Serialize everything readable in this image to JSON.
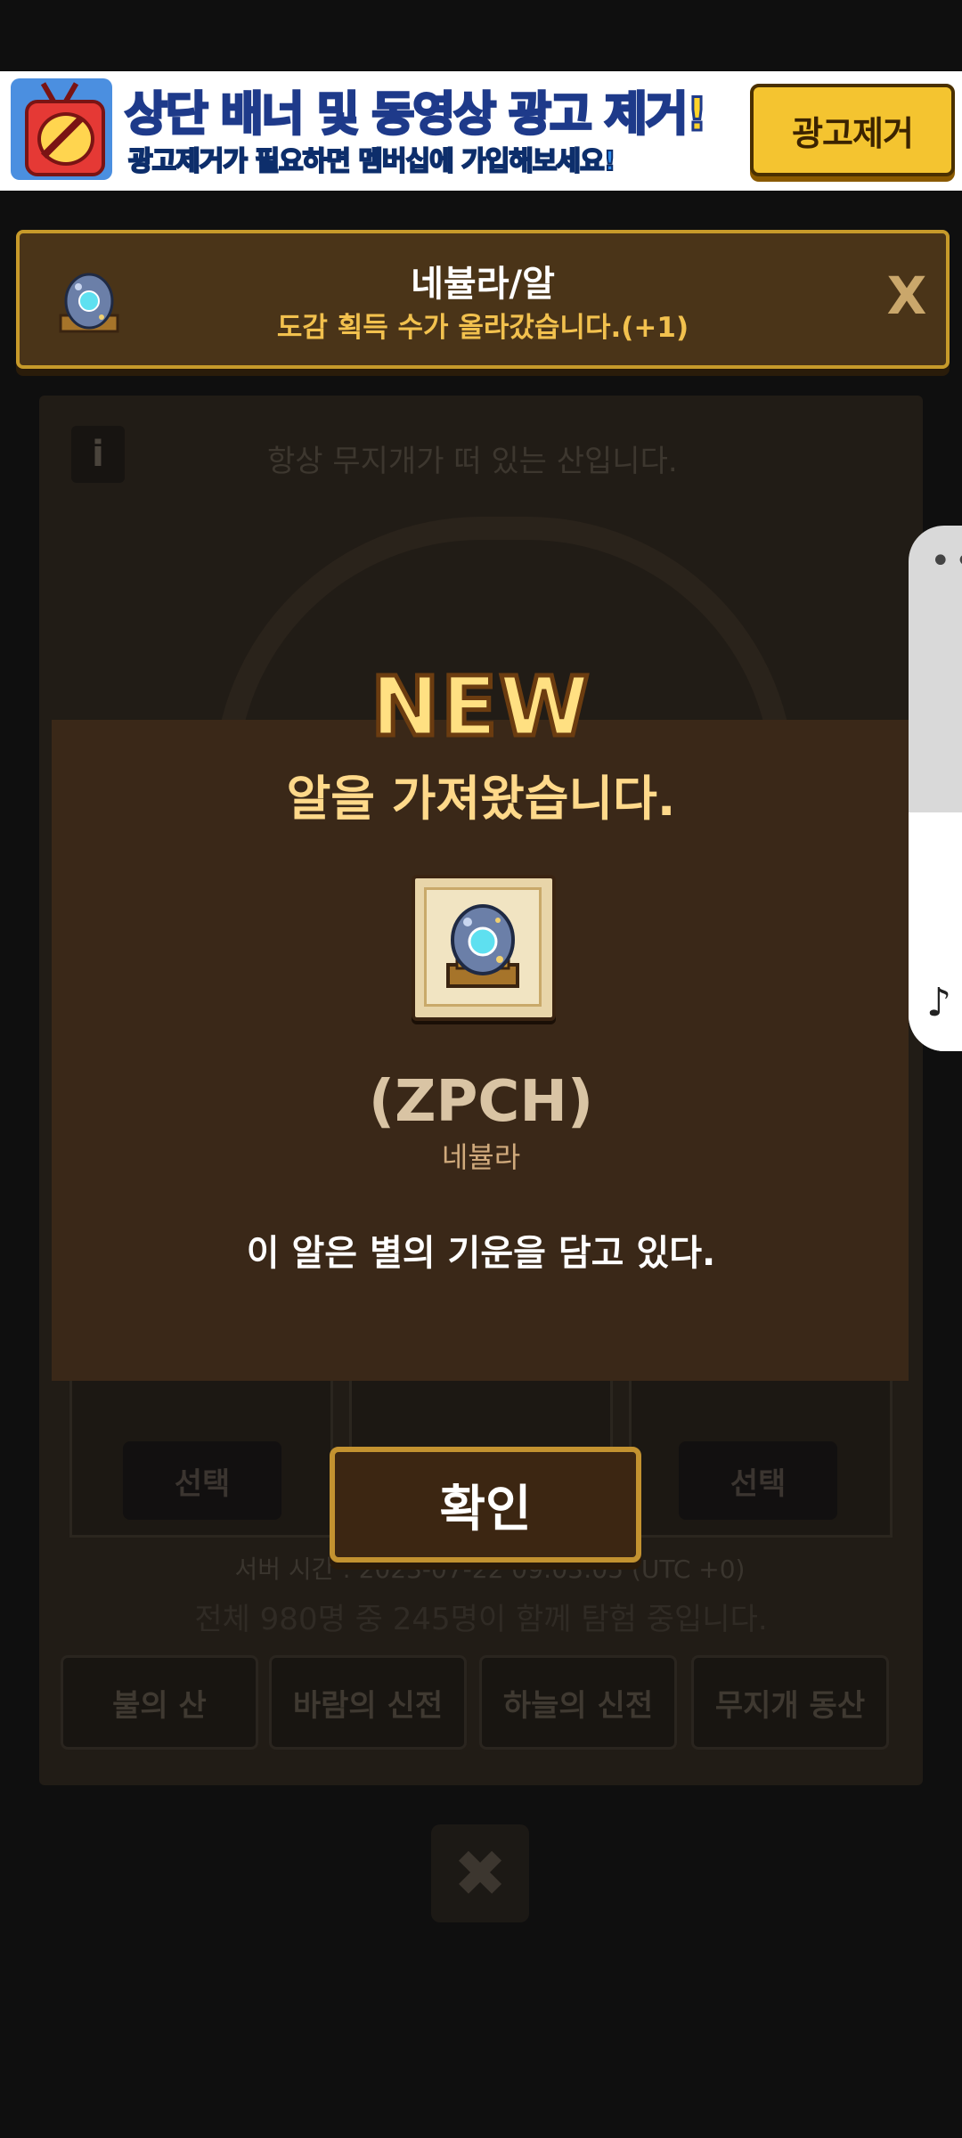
{
  "ad_banner": {
    "title": "상단 배너 및 동영상 광고 제거!",
    "subtitle": "광고제거가 필요하면 멤버십에 가입해보세요!",
    "remove_button": "광고제거",
    "icon": "tv-no-ads-icon"
  },
  "notification": {
    "title": "네뷸라/알",
    "message": "도감 획득 수가 올라갔습니다.(+1)",
    "close_label": "X",
    "icon": "nebula-egg-icon"
  },
  "modal": {
    "badge": "NEW",
    "heading": "알을 가져왔습니다.",
    "item_name": "(ZPCH)",
    "item_subtitle": "네뷸라",
    "description": "이 알은 별의 기운을 담고 있다.",
    "confirm_button": "확인",
    "item_icon": "nebula-egg-icon"
  },
  "background": {
    "info_icon": "i",
    "top_text": "항상 무지개가 떠 있는 산입니다.",
    "select_left": "선택",
    "select_right": "선택",
    "server_time": "서버 시간 : 2023-07-22 09:03:05 (UTC +0)",
    "status": "전체 980명 중 245명이 함께 탐험 중입니다.",
    "tabs": [
      "불의 산",
      "바람의 신전",
      "하늘의 신전",
      "무지개 동산"
    ],
    "close": "✖"
  },
  "side_panel": {
    "dots": "••",
    "music_icon": "♪"
  },
  "colors": {
    "accent_gold": "#c79a2a",
    "heading_yellow": "#ffd98a",
    "panel_brown": "#3a2818"
  }
}
